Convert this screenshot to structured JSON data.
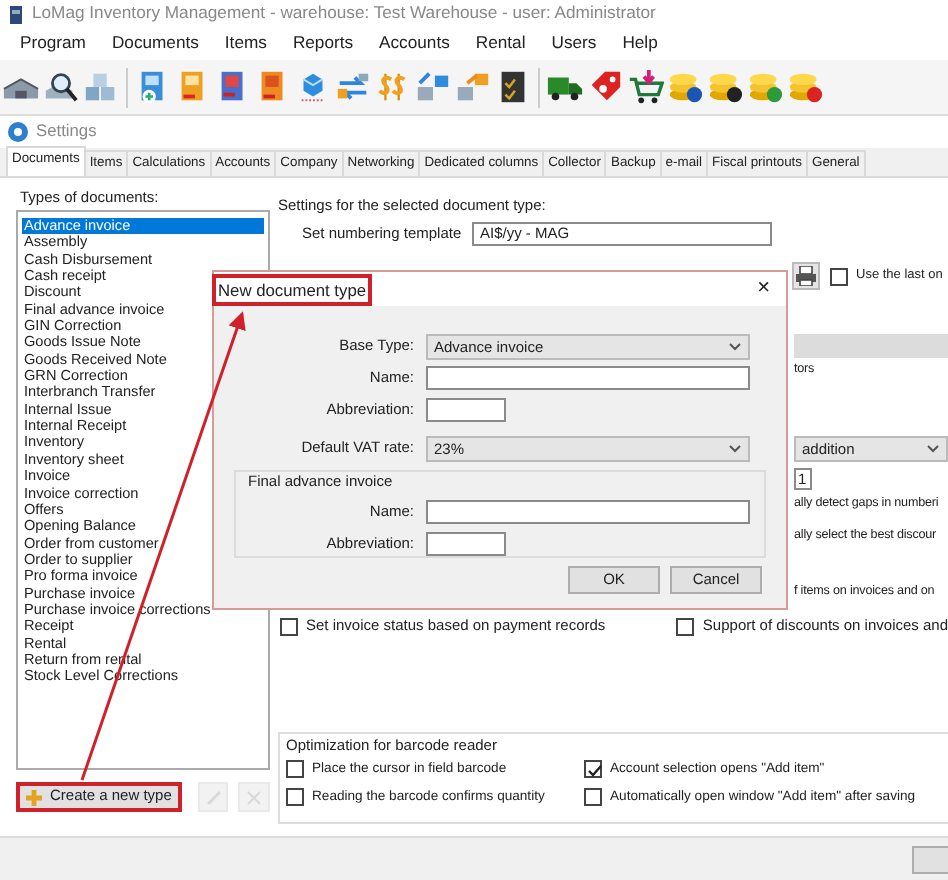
{
  "app": {
    "title": "LoMag Inventory Management - warehouse: Test Warehouse - user: Administrator"
  },
  "menu": [
    "Program",
    "Documents",
    "Items",
    "Reports",
    "Accounts",
    "Rental",
    "Users",
    "Help"
  ],
  "settings_window": {
    "title": "Settings",
    "tabs": [
      {
        "label": "Documents",
        "selected": true
      },
      {
        "label": "Items",
        "selected": false
      },
      {
        "label": "Calculations",
        "selected": false
      },
      {
        "label": "Accounts",
        "selected": false
      },
      {
        "label": "Company",
        "selected": false
      },
      {
        "label": "Networking",
        "selected": false
      },
      {
        "label": "Dedicated columns",
        "selected": false
      },
      {
        "label": "Collector",
        "selected": false
      },
      {
        "label": "Backup",
        "selected": false
      },
      {
        "label": "e-mail",
        "selected": false
      },
      {
        "label": "Fiscal printouts",
        "selected": false
      },
      {
        "label": "General",
        "selected": false
      }
    ]
  },
  "document_types": {
    "label": "Types of documents:",
    "items": [
      {
        "label": "Advance invoice",
        "selected": true
      },
      {
        "label": "Assembly",
        "selected": false
      },
      {
        "label": "Cash Disbursement",
        "selected": false
      },
      {
        "label": "Cash receipt",
        "selected": false
      },
      {
        "label": "Discount",
        "selected": false
      },
      {
        "label": "Final advance invoice",
        "selected": false
      },
      {
        "label": "GIN Correction",
        "selected": false
      },
      {
        "label": "Goods Issue Note",
        "selected": false
      },
      {
        "label": "Goods Received Note",
        "selected": false
      },
      {
        "label": "GRN Correction",
        "selected": false
      },
      {
        "label": "Interbranch Transfer",
        "selected": false
      },
      {
        "label": "Internal Issue",
        "selected": false
      },
      {
        "label": "Internal Receipt",
        "selected": false
      },
      {
        "label": "Inventory",
        "selected": false
      },
      {
        "label": "Inventory sheet",
        "selected": false
      },
      {
        "label": "Invoice",
        "selected": false
      },
      {
        "label": "Invoice correction",
        "selected": false
      },
      {
        "label": "Offers",
        "selected": false
      },
      {
        "label": "Opening Balance",
        "selected": false
      },
      {
        "label": "Order from customer",
        "selected": false
      },
      {
        "label": "Order to supplier",
        "selected": false
      },
      {
        "label": "Pro forma invoice",
        "selected": false
      },
      {
        "label": "Purchase invoice",
        "selected": false
      },
      {
        "label": "Purchase invoice corrections",
        "selected": false
      },
      {
        "label": "Receipt",
        "selected": false
      },
      {
        "label": "Rental",
        "selected": false
      },
      {
        "label": "Return from rental",
        "selected": false
      },
      {
        "label": "Stock Level Corrections",
        "selected": false
      }
    ],
    "buttons": [
      {
        "kind": "create",
        "label": "Create a new type",
        "disabled": false
      },
      {
        "kind": "edit",
        "disabled": true
      },
      {
        "kind": "delete",
        "disabled": true
      }
    ]
  },
  "document_settings": {
    "heading": "Settings for the selected document type:",
    "numbering_template": {
      "label": "Set numbering template",
      "value": "AI$/yy - MAG"
    },
    "use_last": {
      "label": "Use the last on",
      "checked": false
    },
    "obscured_fragments": [
      {
        "kind": "bar"
      },
      {
        "kind": "text",
        "text": "tors"
      },
      {
        "kind": "select",
        "value": "addition"
      },
      {
        "kind": "field",
        "value": "1"
      },
      {
        "kind": "text",
        "text": "ally detect gaps in numberi"
      },
      {
        "kind": "text",
        "text": "ally select the best discour"
      },
      {
        "kind": "text",
        "text": "f items on invoices and on"
      }
    ],
    "options": [
      {
        "label": "Set invoice status based on payment records",
        "checked": false
      },
      {
        "label": "Support of discounts on invoices and",
        "checked": false
      }
    ],
    "barcode_group": {
      "title": "Optimization for barcode reader",
      "options": [
        {
          "label": "Place the cursor in field barcode",
          "checked": false
        },
        {
          "label": "Account selection opens \"Add item\"",
          "checked": true
        },
        {
          "label": "Reading the barcode confirms quantity",
          "checked": false
        },
        {
          "label": "Automatically open window \"Add item\" after saving",
          "checked": false
        }
      ]
    }
  },
  "dialog": {
    "title": "New document type",
    "close": "×",
    "fields": [
      {
        "kind": "select",
        "label": "Base Type:",
        "value": "Advance invoice"
      },
      {
        "kind": "input",
        "label": "Name:"
      },
      {
        "kind": "short",
        "label": "Abbreviation:"
      },
      {
        "kind": "select",
        "label": "Default VAT rate:",
        "value": "23%"
      }
    ],
    "group": {
      "title": "Final advance invoice",
      "fields": [
        {
          "kind": "input",
          "label": "Name:"
        },
        {
          "kind": "short",
          "label": "Abbreviation:"
        }
      ]
    },
    "buttons": [
      "OK",
      "Cancel"
    ]
  }
}
